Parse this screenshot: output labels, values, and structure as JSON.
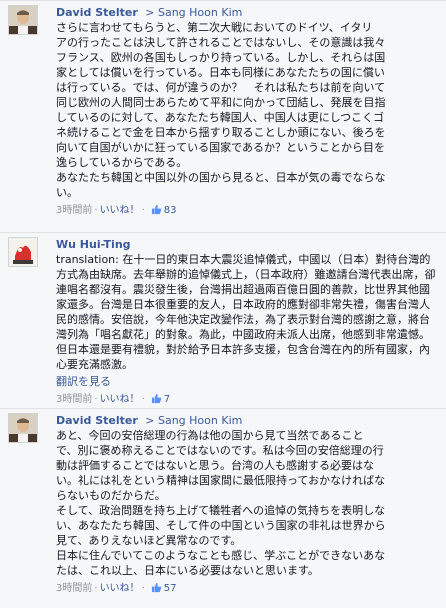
{
  "comments": [
    {
      "author": "David Stelter",
      "target": "Sang Hoon Kim",
      "lines": [
        "さらに言わせてもらうと、第二次大戦においてのドイツ、イタリ",
        "アの行ったことは決して許されることではないし、その意識は我々",
        "フランス、欧州の各国もしっかり持っている。しかし、それらは国",
        "家としては償いを行っている。日本も同様にあなたたちの国に償い",
        "は行っている。では、何が違うのか？　それは私たちは前を向いて",
        "同じ欧州の人間同士あらためて平和に向かって団結し、発展を目指",
        "しているのに対して、あなたたち韓国人、中国人は更にしつこくゴ",
        "ネ続けることで金を日本から揺すり取ることしか頭にない、後ろを",
        "向いて自国がいかに狂っている国家であるか？ということから目を",
        "逸らしているからである。",
        "あなたたち韓国と中国以外の国から見ると、日本が気の毒でならな",
        "い。"
      ],
      "time": "3時間前",
      "like_label": "いいね！",
      "likes": "83"
    },
    {
      "author": "Wu Hui-Ting",
      "lines": [
        "translation: 在十一日的東日本大震災追悼儀式，中國以（日本）對待台灣的方式為由缺席。去年舉辦的追悼儀式上，（日本政府）雖邀請台灣代表出席，卻連唱名都沒有。震災發生後，台灣捐出超過兩百億日圓的善款，比世界其他國家還多。台灣是日本很重要的友人，日本政府的應對卻非常失禮，傷害台灣人民的感情。安倍說，今年他決定改變作法，為了表示對台灣的感謝之意，將台灣列為「唱名獻花」的對象。為此，中國政府未派人出席，他感到非常遺憾。但日本還是要有禮貌，對於給予日本許多支援，包含台灣在內的所有國家，內心要充滿感激。"
      ],
      "see_translation": "翻訳を見る",
      "time": "3時間前",
      "like_label": "いいね！",
      "likes": "7"
    },
    {
      "author": "David Stelter",
      "target": "Sang Hoon Kim",
      "lines": [
        "あと、今回の安倍総理の行為は他の国から見て当然であること",
        "で、別に褒め称えることではないのです。私は今回の安倍総理の行",
        "動は評価することではないと思う。台湾の人も感謝する必要はな",
        "い。礼には礼をという精神は国家間に最低限持っておかなければな",
        "らないものだからだ。",
        "そして、政治問題を持ち上げて犠牲者への追悼の気持ちを表明しな",
        "い、あなたたち韓国、そして件の中国という国家の非礼は世界から",
        "見て、ありえないほど異常なのです。",
        "日本に住んでいてこのようなことも感じ、学ぶことができないあな",
        "たは、これ以上、日本にいる必要はないと思います。"
      ],
      "time": "3時間前",
      "like_label": "いいね！",
      "likes": "57"
    }
  ]
}
